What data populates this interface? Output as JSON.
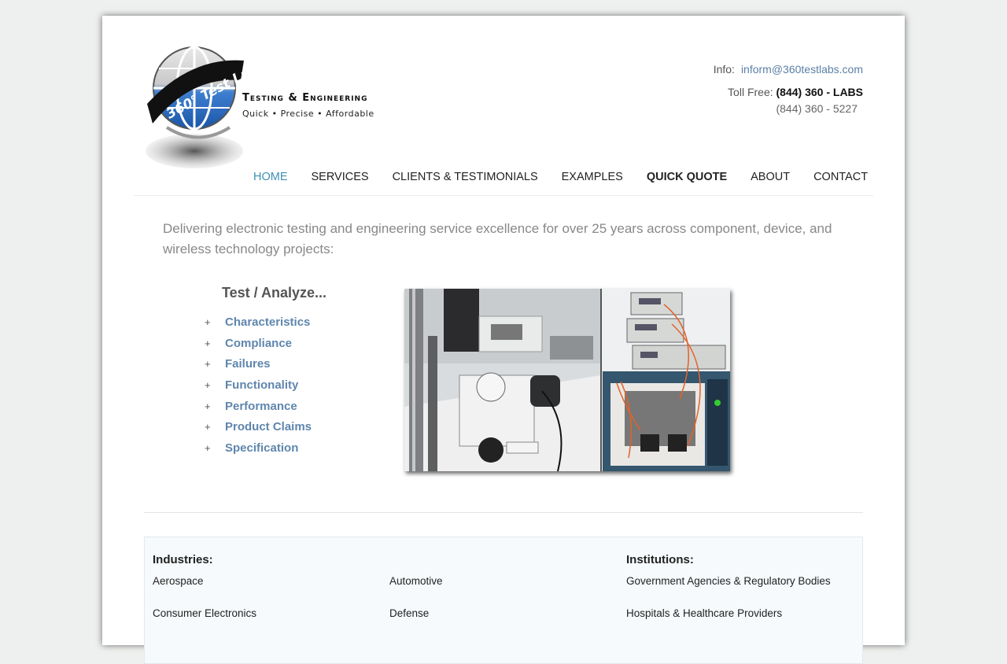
{
  "brand": {
    "logo_text": "360° Test Labs",
    "tagline_main": "Testing & Engineering",
    "tagline_sub": "Quick • Precise • Affordable"
  },
  "contact": {
    "info_label": "Info:",
    "email": "inform@360testlabs.com",
    "tollfree_label": "Toll Free:",
    "tollfree_number": "(844) 360 - LABS",
    "phone_alt": "(844) 360 - 5227"
  },
  "nav": {
    "items": [
      {
        "label": "HOME"
      },
      {
        "label": "SERVICES"
      },
      {
        "label": "CLIENTS & TESTIMONIALS"
      },
      {
        "label": "EXAMPLES"
      },
      {
        "label": "QUICK QUOTE"
      },
      {
        "label": "ABOUT"
      },
      {
        "label": "CONTACT"
      }
    ]
  },
  "intro": "Delivering electronic testing and engineering service excellence for over 25 years across component, device, and wireless technology projects:",
  "test": {
    "heading": "Test / Analyze...",
    "bullet": "+",
    "items": [
      "Characteristics",
      "Compliance",
      "Failures",
      "Functionality",
      "Performance",
      "Product Claims",
      "Specification"
    ]
  },
  "industries": {
    "heading": "Industries:",
    "col1": [
      "Aerospace",
      "Consumer Electronics"
    ],
    "col2": [
      "Automotive",
      "Defense"
    ]
  },
  "institutions": {
    "heading": "Institutions:",
    "items": [
      "Government Agencies & Regulatory Bodies",
      "Hospitals & Healthcare Providers"
    ]
  },
  "colors": {
    "link": "#5a7fa6",
    "nav_active": "#3d8fb5",
    "list_item": "#5f86ad",
    "page_bg": "#eef0ef"
  }
}
